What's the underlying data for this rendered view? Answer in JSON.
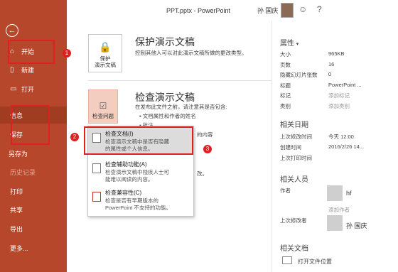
{
  "window": {
    "doc_title": "PPT.pptx - PowerPoint",
    "user_name": "孙 国庆"
  },
  "sidebar": {
    "items": [
      {
        "label": "开始",
        "icon": "home-icon"
      },
      {
        "label": "新建",
        "icon": "new-doc-icon"
      },
      {
        "label": "打开",
        "icon": "folder-icon"
      },
      {
        "label": "信息"
      },
      {
        "label": "保存"
      },
      {
        "label": "另存为"
      },
      {
        "label": "历史记录"
      },
      {
        "label": "打印"
      },
      {
        "label": "共享"
      },
      {
        "label": "导出"
      },
      {
        "label": "更多..."
      }
    ]
  },
  "protect": {
    "tile_label_1": "保护",
    "tile_label_2": "演示文稿",
    "title": "保护演示文稿",
    "desc": "控制其他人可以对此演示文稿所做的更改类型。"
  },
  "inspect": {
    "tile_label": "检查问题",
    "title": "检查演示文稿",
    "desc": "在发布此文件之前，请注意其是否包含:",
    "bullets": [
      "文档属性和作者的姓名",
      "批注"
    ],
    "partial_1": "的内容",
    "partial_2": "改。"
  },
  "menu": [
    {
      "title": "检查文档(I)",
      "desc_1": "检查演示文稿中是否有隐藏",
      "desc_2": "的属性或个人信息。"
    },
    {
      "title": "检查辅助功能(A)",
      "desc_1": "检查演示文稿中残疾人士可",
      "desc_2": "能难以阅读的内容。"
    },
    {
      "title": "检查兼容性(C)",
      "desc_1": "检查是否有早期版本的",
      "desc_2": "PowerPoint 不支持的功能。"
    }
  ],
  "properties": {
    "header": "属性",
    "rows": [
      {
        "key": "大小",
        "value": "965KB"
      },
      {
        "key": "页数",
        "value": "16"
      },
      {
        "key": "隐藏幻灯片张数",
        "value": "0"
      },
      {
        "key": "标题",
        "value": "PowerPoint ..."
      },
      {
        "key": "标记",
        "value": "添加标记"
      },
      {
        "key": "类别",
        "value": "添加类别"
      }
    ]
  },
  "dates": {
    "header": "相关日期",
    "rows": [
      {
        "key": "上次修改时间",
        "value": "今天 12:00"
      },
      {
        "key": "创建时间",
        "value": "2016/2/26 14..."
      },
      {
        "key": "上次打印时间",
        "value": ""
      }
    ]
  },
  "people": {
    "header": "相关人员",
    "author_label": "作者",
    "author_name": "hf",
    "add_author": "添加作者",
    "modified_label": "上次修改者",
    "modified_name": "孙 国庆"
  },
  "docs": {
    "header": "相关文档",
    "open_location": "打开文件位置"
  },
  "annotations": [
    "1",
    "2",
    "3"
  ],
  "colors": {
    "sidebar": "#b7472a",
    "highlight": "#e02020"
  }
}
